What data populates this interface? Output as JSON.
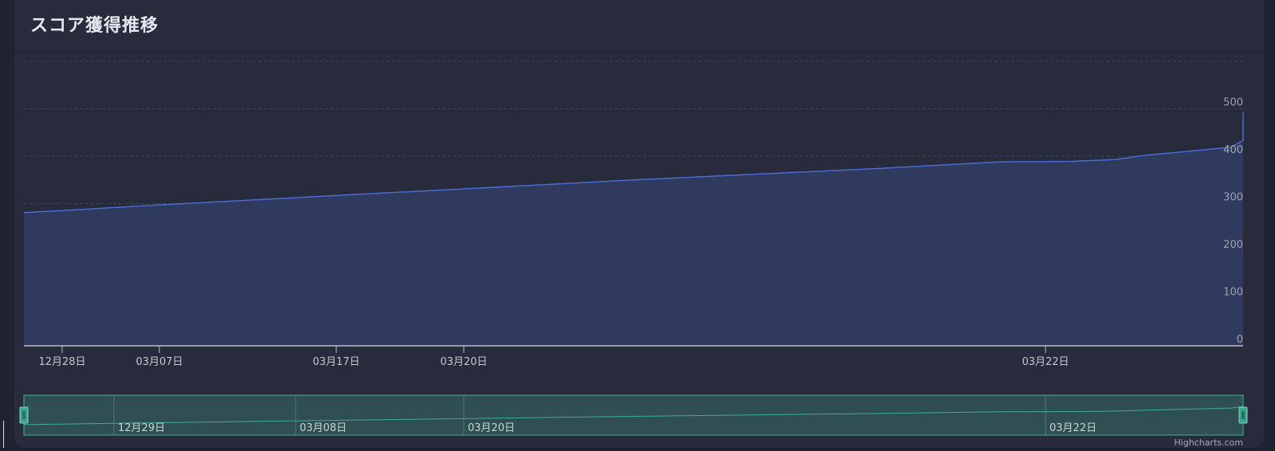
{
  "panel": {
    "title": "スコア獲得推移"
  },
  "credits": "Highcharts.com",
  "colors": {
    "line": "#4a6bd1",
    "area": "#2f3a5e",
    "grid": "#3e4358",
    "navigator_fill": "#2f4f52",
    "navigator_line": "#3fae94",
    "handle": "#3aa58d"
  },
  "chart_data": {
    "type": "area",
    "title": "",
    "xlabel": "",
    "ylabel": "",
    "ylim": [
      0,
      600
    ],
    "y_ticks": [
      0,
      100,
      200,
      300,
      400,
      500
    ],
    "grid": true,
    "x_tick_labels": [
      "12月28日",
      "03月07日",
      "03月17日",
      "03月20日",
      "03月22日"
    ],
    "navigator_labels": [
      "12月29日",
      "03月08日",
      "03月20日",
      "03月22日"
    ],
    "series": [
      {
        "points": [
          {
            "x": 0.0,
            "y": 281
          },
          {
            "x": 0.03,
            "y": 285
          },
          {
            "x": 0.11,
            "y": 297
          },
          {
            "x": 0.255,
            "y": 317
          },
          {
            "x": 0.36,
            "y": 331
          },
          {
            "x": 0.5,
            "y": 350
          },
          {
            "x": 0.7,
            "y": 374
          },
          {
            "x": 0.8,
            "y": 388
          },
          {
            "x": 0.86,
            "y": 389
          },
          {
            "x": 0.895,
            "y": 393
          },
          {
            "x": 0.92,
            "y": 402
          },
          {
            "x": 0.95,
            "y": 409
          },
          {
            "x": 0.99,
            "y": 419
          },
          {
            "x": 1.0,
            "y": 433
          },
          {
            "x": 1.0,
            "y": 493
          }
        ]
      }
    ]
  }
}
